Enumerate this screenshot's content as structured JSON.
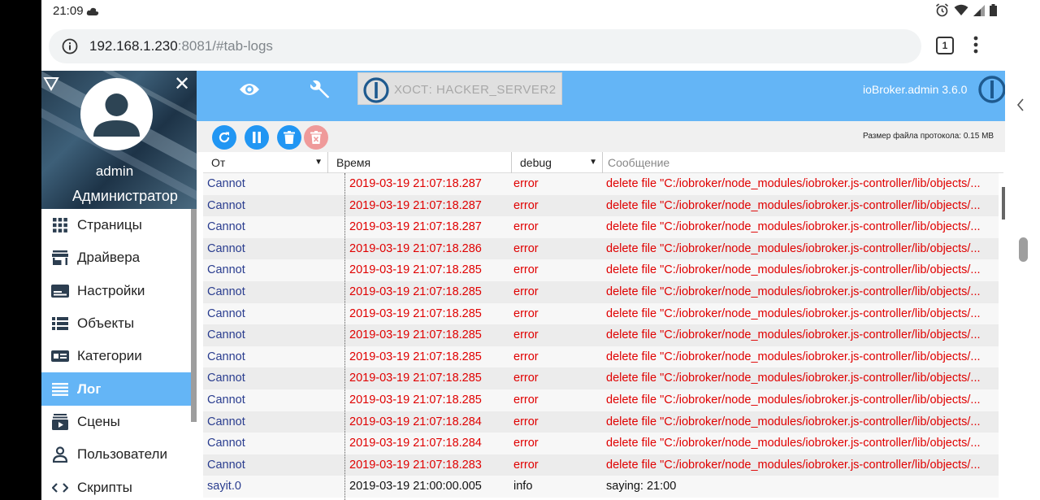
{
  "status_bar": {
    "time": "21:09"
  },
  "browser": {
    "url_host": "192.168.1.230",
    "url_rest": ":8081/#tab-logs",
    "tab_count": "1"
  },
  "sidebar": {
    "user_name": "admin",
    "user_role": "Администратор",
    "items": [
      {
        "label": "Страницы",
        "icon": "grid-icon"
      },
      {
        "label": "Драйвера",
        "icon": "store-icon"
      },
      {
        "label": "Настройки",
        "icon": "settings-panel-icon"
      },
      {
        "label": "Объекты",
        "icon": "list-icon"
      },
      {
        "label": "Категории",
        "icon": "category-icon"
      },
      {
        "label": "Лог",
        "icon": "log-icon",
        "active": true
      },
      {
        "label": "Сцены",
        "icon": "scenes-icon"
      },
      {
        "label": "Пользователи",
        "icon": "user-icon"
      },
      {
        "label": "Скрипты",
        "icon": "script-icon"
      }
    ]
  },
  "topbar": {
    "host": "ХОСТ: HACKER_SERVER2",
    "version": "ioBroker.admin 3.6.0"
  },
  "toolbar": {
    "file_size": "Размер файла протокола: 0.15 MB"
  },
  "log_table": {
    "headers": {
      "from": "От",
      "time": "Время",
      "severity": "debug",
      "message": "Сообщение"
    },
    "rows": [
      {
        "from": "Cannot",
        "time": "2019-03-19 21:07:18.287",
        "severity": "error",
        "message": "delete file \"C:/iobroker/node_modules/iobroker.js-controller/lib/objects/..."
      },
      {
        "from": "Cannot",
        "time": "2019-03-19 21:07:18.287",
        "severity": "error",
        "message": "delete file \"C:/iobroker/node_modules/iobroker.js-controller/lib/objects/..."
      },
      {
        "from": "Cannot",
        "time": "2019-03-19 21:07:18.287",
        "severity": "error",
        "message": "delete file \"C:/iobroker/node_modules/iobroker.js-controller/lib/objects/..."
      },
      {
        "from": "Cannot",
        "time": "2019-03-19 21:07:18.286",
        "severity": "error",
        "message": "delete file \"C:/iobroker/node_modules/iobroker.js-controller/lib/objects/..."
      },
      {
        "from": "Cannot",
        "time": "2019-03-19 21:07:18.285",
        "severity": "error",
        "message": "delete file \"C:/iobroker/node_modules/iobroker.js-controller/lib/objects/..."
      },
      {
        "from": "Cannot",
        "time": "2019-03-19 21:07:18.285",
        "severity": "error",
        "message": "delete file \"C:/iobroker/node_modules/iobroker.js-controller/lib/objects/..."
      },
      {
        "from": "Cannot",
        "time": "2019-03-19 21:07:18.285",
        "severity": "error",
        "message": "delete file \"C:/iobroker/node_modules/iobroker.js-controller/lib/objects/..."
      },
      {
        "from": "Cannot",
        "time": "2019-03-19 21:07:18.285",
        "severity": "error",
        "message": "delete file \"C:/iobroker/node_modules/iobroker.js-controller/lib/objects/..."
      },
      {
        "from": "Cannot",
        "time": "2019-03-19 21:07:18.285",
        "severity": "error",
        "message": "delete file \"C:/iobroker/node_modules/iobroker.js-controller/lib/objects/..."
      },
      {
        "from": "Cannot",
        "time": "2019-03-19 21:07:18.285",
        "severity": "error",
        "message": "delete file \"C:/iobroker/node_modules/iobroker.js-controller/lib/objects/..."
      },
      {
        "from": "Cannot",
        "time": "2019-03-19 21:07:18.285",
        "severity": "error",
        "message": "delete file \"C:/iobroker/node_modules/iobroker.js-controller/lib/objects/..."
      },
      {
        "from": "Cannot",
        "time": "2019-03-19 21:07:18.284",
        "severity": "error",
        "message": "delete file \"C:/iobroker/node_modules/iobroker.js-controller/lib/objects/..."
      },
      {
        "from": "Cannot",
        "time": "2019-03-19 21:07:18.284",
        "severity": "error",
        "message": "delete file \"C:/iobroker/node_modules/iobroker.js-controller/lib/objects/..."
      },
      {
        "from": "Cannot",
        "time": "2019-03-19 21:07:18.283",
        "severity": "error",
        "message": "delete file \"C:/iobroker/node_modules/iobroker.js-controller/lib/objects/..."
      },
      {
        "from": "sayit.0",
        "time": "2019-03-19 21:00:00.005",
        "severity": "info",
        "message": "saying: 21:00"
      }
    ]
  }
}
